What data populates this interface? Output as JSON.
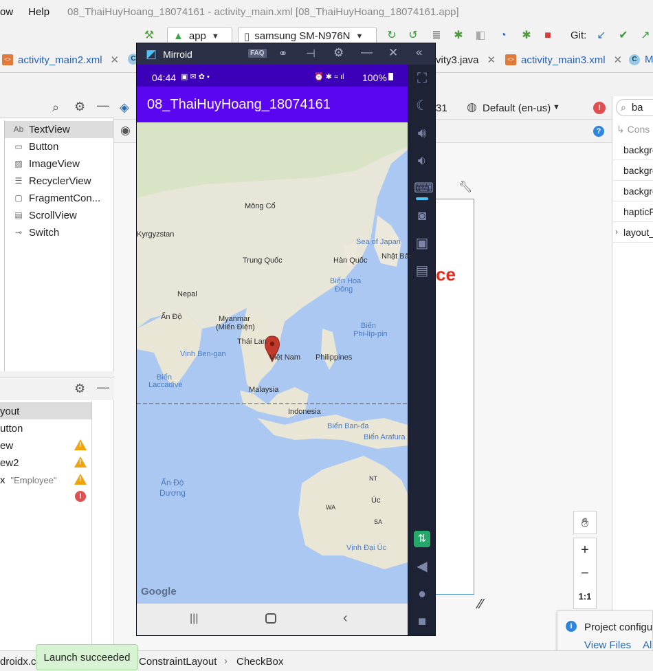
{
  "menu": {
    "items": [
      "ow",
      "Help"
    ],
    "title": "08_ThaiHuyHoang_18074161 - activity_main.xml [08_ThaiHuyHoang_18074161.app]"
  },
  "toolbar": {
    "run_config": "app",
    "device": "samsung SM-N976N",
    "git_label": "Git:"
  },
  "tabs": [
    {
      "label": "activity_main2.xml",
      "kind": "xml"
    },
    {
      "label": "vity3.java",
      "kind": "java"
    },
    {
      "label": "activity_main3.xml",
      "kind": "xml"
    },
    {
      "label": "M",
      "kind": "java"
    }
  ],
  "design_toolbar": {
    "api": "31",
    "locale": "Default (en-us)"
  },
  "palette": {
    "items": [
      {
        "label": "TextView",
        "icon": "Ab"
      },
      {
        "label": "Button",
        "icon": "▭"
      },
      {
        "label": "ImageView",
        "icon": "▨"
      },
      {
        "label": "RecyclerView",
        "icon": "☰"
      },
      {
        "label": "FragmentCon...",
        "icon": "▢"
      },
      {
        "label": "ScrollView",
        "icon": "▤"
      },
      {
        "label": "Switch",
        "icon": "⊸"
      }
    ]
  },
  "component_tree": {
    "rows": [
      {
        "label": "yout",
        "status": ""
      },
      {
        "label": "utton",
        "status": ""
      },
      {
        "label": "ew",
        "status": "warning"
      },
      {
        "label": "ew2",
        "status": "warning"
      },
      {
        "label": "x",
        "extra": "\"Employee\"",
        "status": "warning"
      },
      {
        "label": "",
        "status": "error"
      }
    ]
  },
  "attributes": {
    "search": "ba",
    "constraint_label": "Cons",
    "rows": [
      "backgro",
      "backgro",
      "backgro",
      "hapticFe",
      "layout_c"
    ]
  },
  "canvas": {
    "red_text": "ce",
    "zoom_fit": "1:1"
  },
  "notification": {
    "title": "Project configu",
    "link1": "View Files",
    "link2": "Al"
  },
  "statusbar": {
    "crumb1": "droidx.c",
    "crumb2": "ConstraintLayout",
    "crumb3": "CheckBox",
    "toast": "Launch succeeded"
  },
  "mirroid": {
    "title": "Mirroid",
    "faq": "FAQ",
    "phone": {
      "time": "04:44",
      "battery": "100%",
      "app_title": "08_ThaiHuyHoang_18074161",
      "map_labels": [
        "Mông Cổ",
        "Kyrgyzstan",
        "Trung Quốc",
        "Hàn Quốc",
        "Nhật Bản",
        "Nepal",
        "Ấn Độ",
        "Myanmar",
        "(Miến Điện)",
        "Thái Lan",
        "Việt Nam",
        "Philippines",
        "Malaysia",
        "Indonesia",
        "Úc",
        "NT",
        "WA",
        "SA"
      ],
      "sea_labels": [
        "Sea of Japan",
        "Biển Hoa",
        "Đông",
        "Biển",
        "Phi-líp-pin",
        "Vịnh Ben-gan",
        "Biển",
        "Laccadive",
        "Biển Ban-đa",
        "Biển Arafura",
        "Ấn Độ",
        "Dương",
        "Vịnh Đại Úc"
      ],
      "google": "Google"
    }
  },
  "colors": {
    "appbar": "#5b06f0",
    "statusbar": "#3b00b8",
    "water": "#a9c9f1",
    "marker": "#c0392b"
  }
}
